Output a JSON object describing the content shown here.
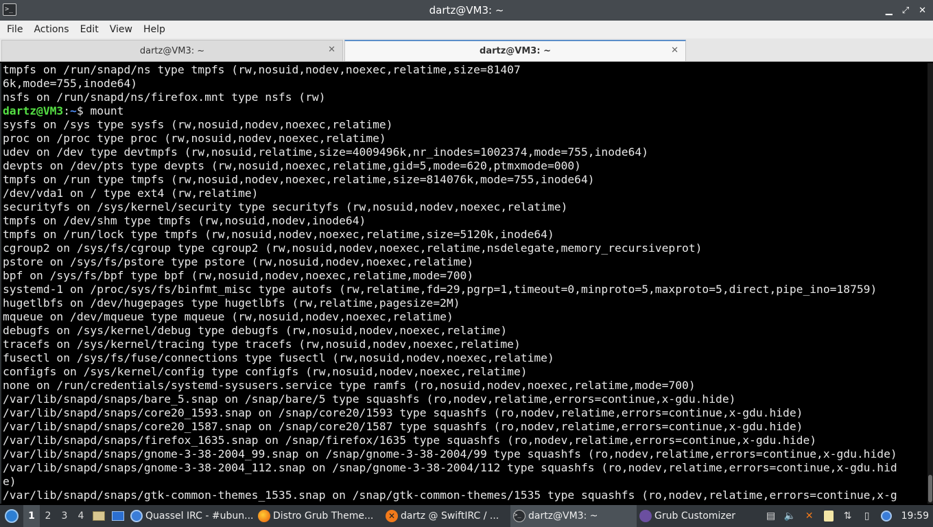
{
  "window": {
    "title": "dartz@VM3: ~",
    "app_icon": ">_",
    "minimize_glyph": "▁",
    "maximize_glyph": "⤢",
    "close_glyph": "✕"
  },
  "menu": {
    "items": [
      "File",
      "Actions",
      "Edit",
      "View",
      "Help"
    ]
  },
  "tabs": [
    {
      "label": "dartz@VM3: ~",
      "active": false
    },
    {
      "label": "dartz@VM3: ~",
      "active": true
    }
  ],
  "tab_close_glyph": "✕",
  "terminal": {
    "prompt": {
      "user_host": "dartz@VM3",
      "sep": ":",
      "path": "~",
      "symbol": "$",
      "command": " mount"
    },
    "lines_before": [
      "tmpfs on /run/snapd/ns type tmpfs (rw,nosuid,nodev,noexec,relatime,size=81407",
      "6k,mode=755,inode64)",
      "nsfs on /run/snapd/ns/firefox.mnt type nsfs (rw)"
    ],
    "lines_after": [
      "sysfs on /sys type sysfs (rw,nosuid,nodev,noexec,relatime)",
      "proc on /proc type proc (rw,nosuid,nodev,noexec,relatime)",
      "udev on /dev type devtmpfs (rw,nosuid,relatime,size=4009496k,nr_inodes=1002374,mode=755,inode64)",
      "devpts on /dev/pts type devpts (rw,nosuid,noexec,relatime,gid=5,mode=620,ptmxmode=000)",
      "tmpfs on /run type tmpfs (rw,nosuid,nodev,noexec,relatime,size=814076k,mode=755,inode64)",
      "/dev/vda1 on / type ext4 (rw,relatime)",
      "securityfs on /sys/kernel/security type securityfs (rw,nosuid,nodev,noexec,relatime)",
      "tmpfs on /dev/shm type tmpfs (rw,nosuid,nodev,inode64)",
      "tmpfs on /run/lock type tmpfs (rw,nosuid,nodev,noexec,relatime,size=5120k,inode64)",
      "cgroup2 on /sys/fs/cgroup type cgroup2 (rw,nosuid,nodev,noexec,relatime,nsdelegate,memory_recursiveprot)",
      "pstore on /sys/fs/pstore type pstore (rw,nosuid,nodev,noexec,relatime)",
      "bpf on /sys/fs/bpf type bpf (rw,nosuid,nodev,noexec,relatime,mode=700)",
      "systemd-1 on /proc/sys/fs/binfmt_misc type autofs (rw,relatime,fd=29,pgrp=1,timeout=0,minproto=5,maxproto=5,direct,pipe_ino=18759)",
      "hugetlbfs on /dev/hugepages type hugetlbfs (rw,relatime,pagesize=2M)",
      "mqueue on /dev/mqueue type mqueue (rw,nosuid,nodev,noexec,relatime)",
      "debugfs on /sys/kernel/debug type debugfs (rw,nosuid,nodev,noexec,relatime)",
      "tracefs on /sys/kernel/tracing type tracefs (rw,nosuid,nodev,noexec,relatime)",
      "fusectl on /sys/fs/fuse/connections type fusectl (rw,nosuid,nodev,noexec,relatime)",
      "configfs on /sys/kernel/config type configfs (rw,nosuid,nodev,noexec,relatime)",
      "none on /run/credentials/systemd-sysusers.service type ramfs (ro,nosuid,nodev,noexec,relatime,mode=700)",
      "/var/lib/snapd/snaps/bare_5.snap on /snap/bare/5 type squashfs (ro,nodev,relatime,errors=continue,x-gdu.hide)",
      "/var/lib/snapd/snaps/core20_1593.snap on /snap/core20/1593 type squashfs (ro,nodev,relatime,errors=continue,x-gdu.hide)",
      "/var/lib/snapd/snaps/core20_1587.snap on /snap/core20/1587 type squashfs (ro,nodev,relatime,errors=continue,x-gdu.hide)",
      "/var/lib/snapd/snaps/firefox_1635.snap on /snap/firefox/1635 type squashfs (ro,nodev,relatime,errors=continue,x-gdu.hide)",
      "/var/lib/snapd/snaps/gnome-3-38-2004_99.snap on /snap/gnome-3-38-2004/99 type squashfs (ro,nodev,relatime,errors=continue,x-gdu.hide)",
      "/var/lib/snapd/snaps/gnome-3-38-2004_112.snap on /snap/gnome-3-38-2004/112 type squashfs (ro,nodev,relatime,errors=continue,x-gdu.hid",
      "e)",
      "/var/lib/snapd/snaps/gtk-common-themes_1535.snap on /snap/gtk-common-themes/1535 type squashfs (ro,nodev,relatime,errors=continue,x-g"
    ]
  },
  "taskbar": {
    "desktops": [
      "1",
      "2",
      "3",
      "4"
    ],
    "tasks": [
      {
        "label": "Quassel IRC - #ubun...",
        "icon": "quassel-icon"
      },
      {
        "label": "Distro Grub Theme...",
        "icon": "firefox-icon"
      },
      {
        "label": "dartz @ SwiftIRC / ...",
        "icon": "hexchat-icon"
      },
      {
        "label": "dartz@VM3: ~",
        "icon": "terminal-icon"
      },
      {
        "label": "Grub Customizer",
        "icon": "grub-customizer-icon"
      }
    ],
    "tray_glyphs": {
      "clipboard": "▤",
      "volume": "🔈",
      "network": "⇅",
      "battery": "▯"
    },
    "clock": "19:59"
  },
  "colors": {
    "prompt_user": "#55e044",
    "prompt_path": "#4f8ef7",
    "terminal_bg": "#000000",
    "titlebar_bg": "#454a4f"
  }
}
